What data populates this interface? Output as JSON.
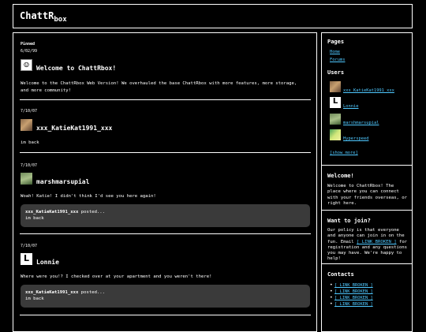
{
  "header": {
    "brand_main": "ChattR",
    "brand_sub": "box"
  },
  "posts": [
    {
      "pinned_label": "Pinned",
      "date": "6/02/99",
      "avatar_icon": "smiley-icon",
      "user": "Welcome to ChattRbox!",
      "body": "Welcome to the ChattRbox Web Version! We overhauled the base ChattRbox with more features, more storage, and more community!"
    },
    {
      "date": "7/10/07",
      "avatar_icon": "katie-avatar",
      "user": "xxx_KatieKat1991_xxx",
      "body": "im back"
    },
    {
      "date": "7/10/07",
      "avatar_icon": "marsh-avatar",
      "user": "marshmarsupial",
      "body": "Woah! Katie! I didn't think I'd see you here again!",
      "reply": {
        "user": "xxx_KatieKat1991_xxx",
        "suffix": " posted...",
        "text": "im back"
      }
    },
    {
      "date": "7/10/07",
      "avatar_icon": "lonnie-avatar",
      "user": "Lonnie",
      "body": "Where were you!? I checked over at your apartment and you weren't there!",
      "reply": {
        "user": "xxx_KatieKat1991_xxx",
        "suffix": " posted...",
        "text": "im back"
      }
    }
  ],
  "sidebar": {
    "pages_heading": "Pages",
    "pages": [
      "Home",
      "Forums"
    ],
    "users_heading": "Users",
    "users": [
      {
        "name": "xxx_KatieKat1991_xxx",
        "icon": "katie-avatar"
      },
      {
        "name": "Lonnie",
        "icon": "lonnie-avatar"
      },
      {
        "name": "marshmarsupial",
        "icon": "marsh-avatar"
      },
      {
        "name": "Hyperspeed",
        "icon": "hyperspeed-avatar"
      }
    ],
    "show_more": "[show more]",
    "welcome_heading": "Welcome!",
    "welcome_text": "Welcome to ChattRbox! The place where you can connect with your friends overseas, or right here.",
    "join_heading": "Want to join?",
    "join_text_1": "Our policy is that everyone and anyone can join in on the fun. Email ",
    "join_link": "[ LINK BROKEN ]",
    "join_text_2": " for registration and any questions you may have. We're happy to help!",
    "contacts_heading": "Contacts",
    "contacts": [
      "[ LINK BROKEN ]",
      "[ LINK BROKEN ]",
      "[ LINK BROKEN ]",
      "[ LINK BROKEN ]"
    ]
  },
  "colors": {
    "background": "#000000",
    "text": "#ffffff",
    "link": "#4fc8ff",
    "reply_bg": "#3a3a3a"
  }
}
